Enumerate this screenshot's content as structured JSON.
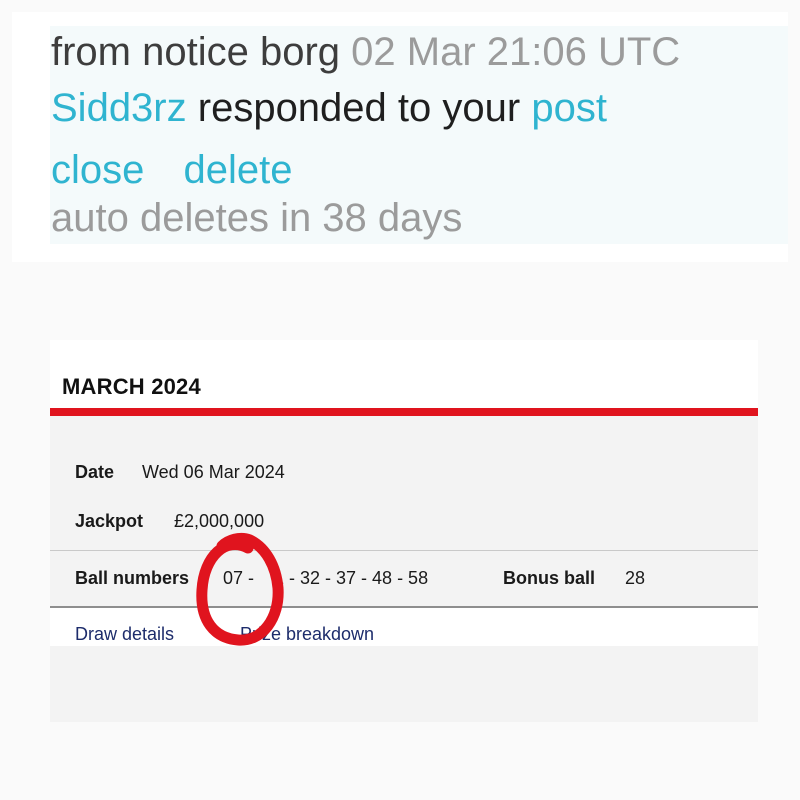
{
  "notification": {
    "from_prefix": "from",
    "sender": "notice borg",
    "timestamp": "02 Mar 21:06 UTC",
    "user": "Sidd3rz",
    "message": "responded to your",
    "post_link": "post",
    "close_label": "close",
    "delete_label": "delete",
    "auto_delete": "auto deletes in 38 days"
  },
  "draw": {
    "title": "MARCH 2024",
    "date_label": "Date",
    "date_value": "Wed 06 Mar 2024",
    "jackpot_label": "Jackpot",
    "jackpot_value": "£2,000,000",
    "ball_label": "Ball numbers",
    "ball_first": "07 -",
    "ball_rest": "1 - 32 - 37 - 48 - 58",
    "bonus_label": "Bonus ball",
    "bonus_value": "28",
    "draw_details_link": "Draw details",
    "prize_breakdown_link": "Prize breakdown"
  },
  "colors": {
    "link_teal": "#2fb4d0",
    "accent_red": "#e0141e",
    "link_navy": "#1d2c6b",
    "annotation_red": "#e0141e"
  }
}
